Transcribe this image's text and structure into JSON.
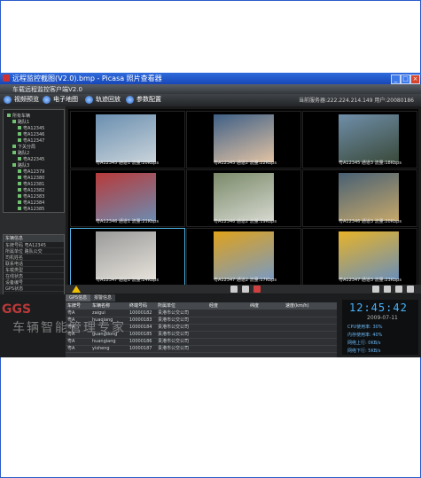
{
  "window": {
    "title": "远程监控截图(V2.0).bmp - Picasa 照片查看器",
    "minimize": "_",
    "maximize": "□",
    "close": "×"
  },
  "app": {
    "title": "车载远程监控客户端V2.0",
    "toolbar": [
      "视频预览",
      "电子地图",
      "轨迹回放",
      "参数配置"
    ],
    "server": "当前服务器:222.224.214.149  用户:20080186"
  },
  "tree": {
    "items": [
      "所有车辆",
      "路队1",
      "粤A12345",
      "粤A12346",
      "粤A12347",
      "下关分局",
      "路队2",
      "粤A22345",
      "路队3",
      "粤A12379",
      "粤A12380",
      "粤A12381",
      "粤A12382",
      "粤A12383",
      "粤A12384",
      "粤A12385"
    ]
  },
  "info": {
    "header": "车辆信息",
    "rows": [
      "车牌号码  粤A12345",
      "所属单位  路队公交",
      "司机姓名",
      "联系电话",
      "车载类型",
      "在线状态",
      "设备编号",
      "GPS状态"
    ]
  },
  "video": {
    "tiles": [
      {
        "caption": "粤A12345 通道1 流量:20Kbps"
      },
      {
        "caption": "粤A12345 通道2 流量:22Kbps"
      },
      {
        "caption": "粤A12345 通道3 流量:18Kbps"
      },
      {
        "caption": "粤A12346 通道1 流量:21Kbps"
      },
      {
        "caption": "粤A12346 通道2 流量:19Kbps"
      },
      {
        "caption": "粤A12346 通道3 流量:20Kbps"
      },
      {
        "caption": "粤A12347 通道1 流量:24Kbps"
      },
      {
        "caption": "粤A12347 通道2 流量:17Kbps"
      },
      {
        "caption": "粤A12347 通道3 流量:23Kbps"
      }
    ]
  },
  "bottom": {
    "tabs": [
      "GPS信息",
      "报警信息"
    ],
    "columns": [
      "车牌号",
      "车辆名称",
      "终端号码",
      "所属单位",
      "经度",
      "纬度",
      "速度(km/h)"
    ],
    "rows": [
      [
        "粤A",
        "zaigui",
        "10000182",
        "贵港市公交公司"
      ],
      [
        "粤A",
        "huaqiang",
        "10000183",
        "贵港市公交公司"
      ],
      [
        "粤A",
        "",
        "10000184",
        "贵港市公交公司"
      ],
      [
        "粤A",
        "guangdong",
        "10000185",
        "贵港市公交公司"
      ],
      [
        "粤A",
        "huangiang",
        "10000186",
        "贵港市公交公司"
      ],
      [
        "粤A",
        "yisheng",
        "10000187",
        "贵港市公交公司"
      ]
    ]
  },
  "clock": {
    "time": "12:45:42",
    "date": "2009-07-11",
    "stats": [
      "CPU使用率: 30%",
      "内存使用率: 40%",
      "网络上行: 0KB/s",
      "网络下行: 5KB/s"
    ]
  },
  "watermark": {
    "logo": "GGS",
    "text": "车辆智能管理专家"
  }
}
